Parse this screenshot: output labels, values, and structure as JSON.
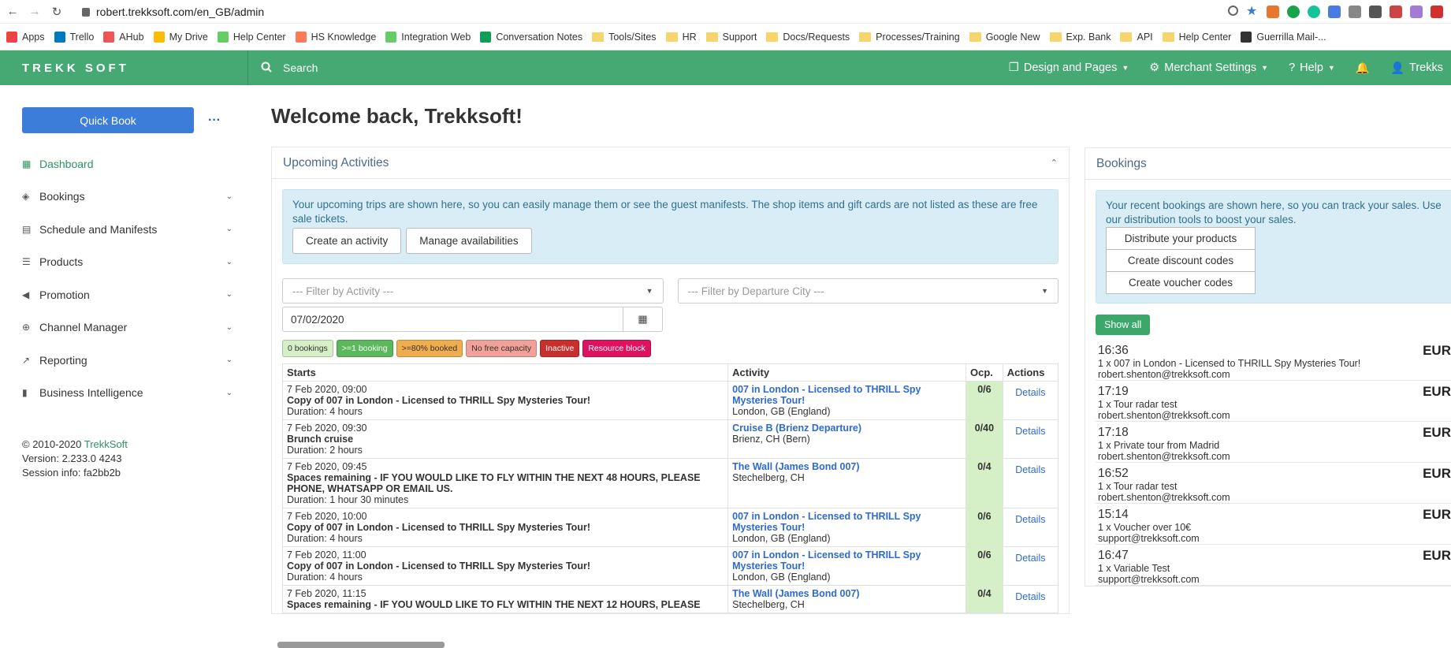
{
  "browser": {
    "url": "robert.trekksoft.com/en_GB/admin",
    "bookmarks": [
      "Apps",
      "Trello",
      "AHub",
      "My Drive",
      "Help Center",
      "HS Knowledge",
      "Integration Web",
      "Conversation Notes",
      "Tools/Sites",
      "HR",
      "Support",
      "Docs/Requests",
      "Processes/Training",
      "Google New",
      "Exp. Bank",
      "API",
      "Help Center",
      "Guerrilla Mail-..."
    ]
  },
  "appbar": {
    "logo": "TREKK  SOFT",
    "search": "Search",
    "design": "Design and Pages",
    "merchant": "Merchant Settings",
    "help": "Help",
    "user": "Trekks"
  },
  "sidebar": {
    "quick_book": "Quick Book",
    "more": "···",
    "items": [
      {
        "label": "Dashboard"
      },
      {
        "label": "Bookings"
      },
      {
        "label": "Schedule and Manifests"
      },
      {
        "label": "Products"
      },
      {
        "label": "Promotion"
      },
      {
        "label": "Channel Manager"
      },
      {
        "label": "Reporting"
      },
      {
        "label": "Business Intelligence"
      }
    ],
    "footer": {
      "copyright": "© 2010-2020 ",
      "brand": "TrekkSoft",
      "version": "Version: 2.233.0 4243",
      "session": "Session info: fa2bb2b"
    }
  },
  "main": {
    "title": "Welcome back, Trekksoft!",
    "upcoming": {
      "heading": "Upcoming Activities",
      "info": "Your upcoming trips are shown here, so you can easily manage them or see the guest manifests. The shop items and gift cards are not listed as these are free sale tickets.",
      "create": "Create an activity",
      "manage": "Manage availabilities",
      "filter_activity": "--- Filter by Activity ---",
      "filter_city": "--- Filter by Departure City ---",
      "date": "07/02/2020",
      "legend": [
        {
          "label": "0 bookings",
          "bg": "#d5efc7",
          "fg": "#333"
        },
        {
          "label": ">=1 booking",
          "bg": "#5cb85c",
          "fg": "#fff"
        },
        {
          "label": ">=80% booked",
          "bg": "#f0ad4e",
          "fg": "#333"
        },
        {
          "label": "No free capacity",
          "bg": "#f2a09a",
          "fg": "#333"
        },
        {
          "label": "Inactive",
          "bg": "#c9302c",
          "fg": "#fff"
        },
        {
          "label": "Resource block",
          "bg": "#e0115f",
          "fg": "#fff"
        }
      ],
      "columns": [
        "Starts",
        "Activity",
        "Ocp.",
        "Actions"
      ],
      "rows": [
        {
          "date": "7 Feb 2020, 09:00",
          "name": "Copy of 007 in London - Licensed to THRILL Spy Mysteries Tour!",
          "duration": "Duration: 4 hours",
          "activity": "007 in London - Licensed to THRILL Spy Mysteries Tour!",
          "location": "London, GB (England)",
          "ocp": "0/6",
          "action": "Details"
        },
        {
          "date": "7 Feb 2020, 09:30",
          "name": "Brunch cruise",
          "duration": "Duration: 2 hours",
          "activity": "Cruise B (Brienz Departure)",
          "location": "Brienz, CH (Bern)",
          "ocp": "0/40",
          "action": "Details"
        },
        {
          "date": "7 Feb 2020, 09:45",
          "name": "Spaces remaining - IF YOU WOULD LIKE TO FLY WITHIN THE NEXT 48 HOURS, PLEASE PHONE, WHATSAPP OR EMAIL US.",
          "duration": "Duration: 1 hour 30 minutes",
          "activity": "The Wall (James Bond 007)",
          "location": "Stechelberg, CH",
          "ocp": "0/4",
          "action": "Details"
        },
        {
          "date": "7 Feb 2020, 10:00",
          "name": "Copy of 007 in London - Licensed to THRILL Spy Mysteries Tour!",
          "duration": "Duration: 4 hours",
          "activity": "007 in London - Licensed to THRILL Spy Mysteries Tour!",
          "location": "London, GB (England)",
          "ocp": "0/6",
          "action": "Details"
        },
        {
          "date": "7 Feb 2020, 11:00",
          "name": "Copy of 007 in London - Licensed to THRILL Spy Mysteries Tour!",
          "duration": "Duration: 4 hours",
          "activity": "007 in London - Licensed to THRILL Spy Mysteries Tour!",
          "location": "London, GB (England)",
          "ocp": "0/6",
          "action": "Details"
        },
        {
          "date": "7 Feb 2020, 11:15",
          "name": "Spaces remaining - IF YOU WOULD LIKE TO FLY WITHIN THE NEXT 12 HOURS, PLEASE",
          "duration": "",
          "activity": "The Wall (James Bond 007)",
          "location": "Stechelberg, CH",
          "ocp": "0/4",
          "action": "Details"
        }
      ]
    },
    "bookings": {
      "heading": "Bookings",
      "info": "Your recent bookings are shown here, so you can track your sales. Use our distribution tools to boost your sales.",
      "distribute": "Distribute your products",
      "discount": "Create discount codes",
      "voucher": "Create voucher codes",
      "show_all": "Show all",
      "items": [
        {
          "time": "16:36",
          "desc": "1 x 007 in London - Licensed to THRILL Spy Mysteries Tour!",
          "email": "robert.shenton@trekksoft.com",
          "currency": "EUR"
        },
        {
          "time": "17:19",
          "desc": "1 x Tour radar test",
          "email": "robert.shenton@trekksoft.com",
          "currency": "EUR"
        },
        {
          "time": "17:18",
          "desc": "1 x Private tour from Madrid",
          "email": "robert.shenton@trekksoft.com",
          "currency": "EUR"
        },
        {
          "time": "16:52",
          "desc": "1 x Tour radar test",
          "email": "robert.shenton@trekksoft.com",
          "currency": "EUR"
        },
        {
          "time": "15:14",
          "desc": "1 x Voucher over 10€",
          "email": "support@trekksoft.com",
          "currency": "EUR"
        },
        {
          "time": "16:47",
          "desc": "1 x Variable Test",
          "email": "support@trekksoft.com",
          "currency": "EUR"
        }
      ]
    }
  }
}
